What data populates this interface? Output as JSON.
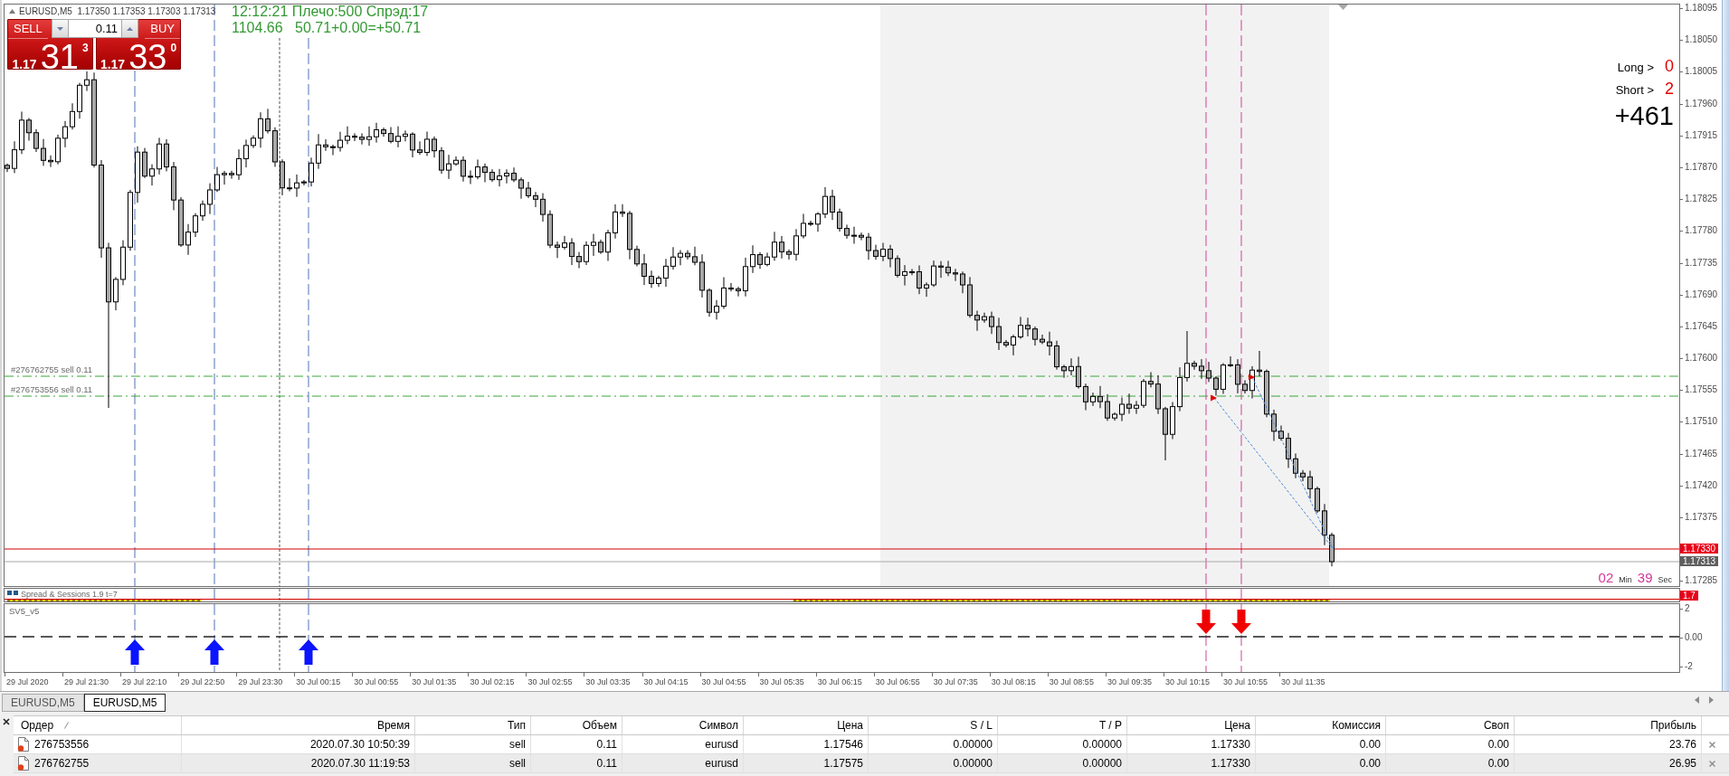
{
  "chart": {
    "symbol_line": "EURUSD,M5  1.17350 1.17353 1.17303 1.17313",
    "one_click": {
      "sell": {
        "label": "SELL",
        "price_prefix": "1.17",
        "price_main": "31",
        "price_sup": "3"
      },
      "lot": "0.11",
      "buy": {
        "label": "BUY",
        "price_prefix": "1.17",
        "price_main": "33",
        "price_sup": "0"
      }
    },
    "info_lines": [
      "12:12:21 Плечо:500 Спрэд:17",
      "1104.66   50.71+0.00=+50.71"
    ],
    "positions": {
      "long": {
        "label": "Long >",
        "count": "0"
      },
      "short": {
        "label": "Short >",
        "count": "2"
      },
      "total": "+461"
    },
    "order_labels": [
      "#276762755 sell 0.11",
      "#276753556 sell 0.11"
    ],
    "countdown": {
      "minutes": "02",
      "minutes_unit": "Min",
      "seconds": "39",
      "seconds_unit": "Sec"
    },
    "price_axis": {
      "ticks": [
        "1.18095",
        "1.18050",
        "1.18005",
        "1.17960",
        "1.17915",
        "1.17870",
        "1.17825",
        "1.17780",
        "1.17735",
        "1.17690",
        "1.17645",
        "1.17600",
        "1.17555",
        "1.17510",
        "1.17465",
        "1.17420",
        "1.17375",
        "1.17285"
      ],
      "tags": [
        {
          "kind": "ask",
          "text": "1.17330"
        },
        {
          "kind": "bid",
          "text": "1.17313"
        }
      ]
    }
  },
  "indicator_1": {
    "name": "Spread & Sessions 1.9 t=7",
    "tag": "1.7"
  },
  "indicator_2": {
    "name": "SV5_v5",
    "ticks": [
      "2",
      "0.00",
      "-2"
    ]
  },
  "time_axis": [
    "29 Jul 2020",
    "29 Jul 21:30",
    "29 Jul 22:10",
    "29 Jul 22:50",
    "29 Jul 23:30",
    "30 Jul 00:15",
    "30 Jul 00:55",
    "30 Jul 01:35",
    "30 Jul 02:15",
    "30 Jul 02:55",
    "30 Jul 03:35",
    "30 Jul 04:15",
    "30 Jul 04:55",
    "30 Jul 05:35",
    "30 Jul 06:15",
    "30 Jul 06:55",
    "30 Jul 07:35",
    "30 Jul 08:15",
    "30 Jul 08:55",
    "30 Jul 09:35",
    "30 Jul 10:15",
    "30 Jul 10:55",
    "30 Jul 11:35"
  ],
  "tabs": [
    {
      "label": "EURUSD,M5",
      "selected": false
    },
    {
      "label": "EURUSD,M5",
      "selected": true
    }
  ],
  "terminal": {
    "columns": [
      "Ордер",
      "Время",
      "Тип",
      "Объем",
      "Символ",
      "Цена",
      "S / L",
      "T / P",
      "Цена",
      "Комиссия",
      "Своп",
      "Прибыль"
    ],
    "rows": [
      {
        "cells": [
          "276753556",
          "2020.07.30 10:50:39",
          "sell",
          "0.11",
          "eurusd",
          "1.17546",
          "0.00000",
          "0.00000",
          "1.17330",
          "0.00",
          "0.00",
          "23.76"
        ]
      },
      {
        "cells": [
          "276762755",
          "2020.07.30 11:19:53",
          "sell",
          "0.11",
          "eurusd",
          "1.17575",
          "0.00000",
          "0.00000",
          "1.17330",
          "0.00",
          "0.00",
          "26.95"
        ]
      }
    ]
  }
}
